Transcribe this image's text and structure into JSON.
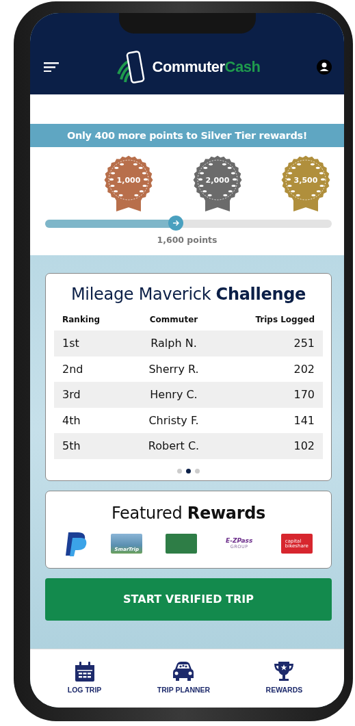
{
  "header": {
    "brand_first": "Commuter",
    "brand_second": "Cash"
  },
  "progress": {
    "banner": "Only 400 more points to Silver Tier rewards!",
    "tiers": [
      {
        "label": "1,000",
        "color": "#b86f4b"
      },
      {
        "label": "2,000",
        "color": "#6b6b6b"
      },
      {
        "label": "3,500",
        "color": "#b08f3c"
      }
    ],
    "level": 0.455,
    "reading": "1,600 points"
  },
  "challenge": {
    "title": "Mileage Maverick **Challenge**",
    "columns": [
      "Ranking",
      "Commuter",
      "Trips Logged"
    ],
    "rows": [
      {
        "ranking": "1st",
        "commuter": "Ralph N.",
        "trips": "251"
      },
      {
        "ranking": "2nd",
        "commuter": "Sherry R.",
        "trips": "202"
      },
      {
        "ranking": "3rd",
        "commuter": "Henry C.",
        "trips": "170"
      },
      {
        "ranking": "4th",
        "commuter": "Christy F.",
        "trips": "141"
      },
      {
        "ranking": "5th",
        "commuter": "Robert C.",
        "trips": "102"
      }
    ],
    "pages": [
      {
        "selected": false
      },
      {
        "selected": true
      },
      {
        "selected": false
      }
    ]
  },
  "rewards": {
    "title": "Featured **Rewards**",
    "items": [
      {
        "kind": "paypal"
      },
      {
        "kind": "smartrip",
        "text": "SmarTrip"
      },
      {
        "kind": "card"
      },
      {
        "kind": "ezpass",
        "text": "E-ZPass",
        "subtext": "GROUP"
      },
      {
        "kind": "bikeshare",
        "text": "capital",
        "subtext": "bikeshare"
      }
    ]
  },
  "action": {
    "label": "START VERIFIED TRIP"
  },
  "nav": [
    {
      "kind": "calendar",
      "label": "LOG TRIP"
    },
    {
      "kind": "car",
      "label": "TRIP PLANNER"
    },
    {
      "kind": "trophy",
      "label": "REWARDS"
    }
  ]
}
